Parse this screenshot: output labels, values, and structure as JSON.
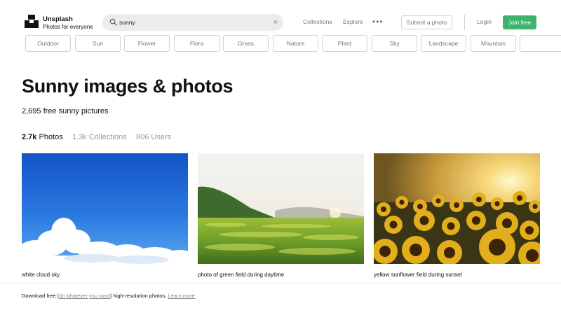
{
  "header": {
    "brand_name": "Unsplash",
    "brand_tagline": "Photos for everyone",
    "search_value": "sunny",
    "search_icon": "search-icon",
    "clear_glyph": "×",
    "nav": {
      "collections": "Collections",
      "explore": "Explore",
      "more": "•••"
    },
    "submit_label": "Submit a photo",
    "login_label": "Login",
    "join_label": "Join free",
    "join_color": "#3cb46e"
  },
  "tags": [
    "Outdoor",
    "Sun",
    "Flower",
    "Flora",
    "Grass",
    "Nature",
    "Plant",
    "Sky",
    "Landscape",
    "Mountain"
  ],
  "page": {
    "title": "Sunny images & photos",
    "count_text": "2,695 free sunny pictures"
  },
  "tabs": [
    {
      "num": "2.7k",
      "label": "Photos",
      "active": true
    },
    {
      "num": "1.3k",
      "label": "Collections",
      "active": false
    },
    {
      "num": "806",
      "label": "Users",
      "active": false
    }
  ],
  "photos": [
    {
      "caption": "white cloud sky"
    },
    {
      "caption": "photo of green field during daytime"
    },
    {
      "caption": "yellow sunflower field during sunset"
    }
  ],
  "footer": {
    "prefix": "Download free (",
    "link1": "do whatever you want",
    "middle": ") high-resolution photos.",
    "link2": "Learn more"
  }
}
